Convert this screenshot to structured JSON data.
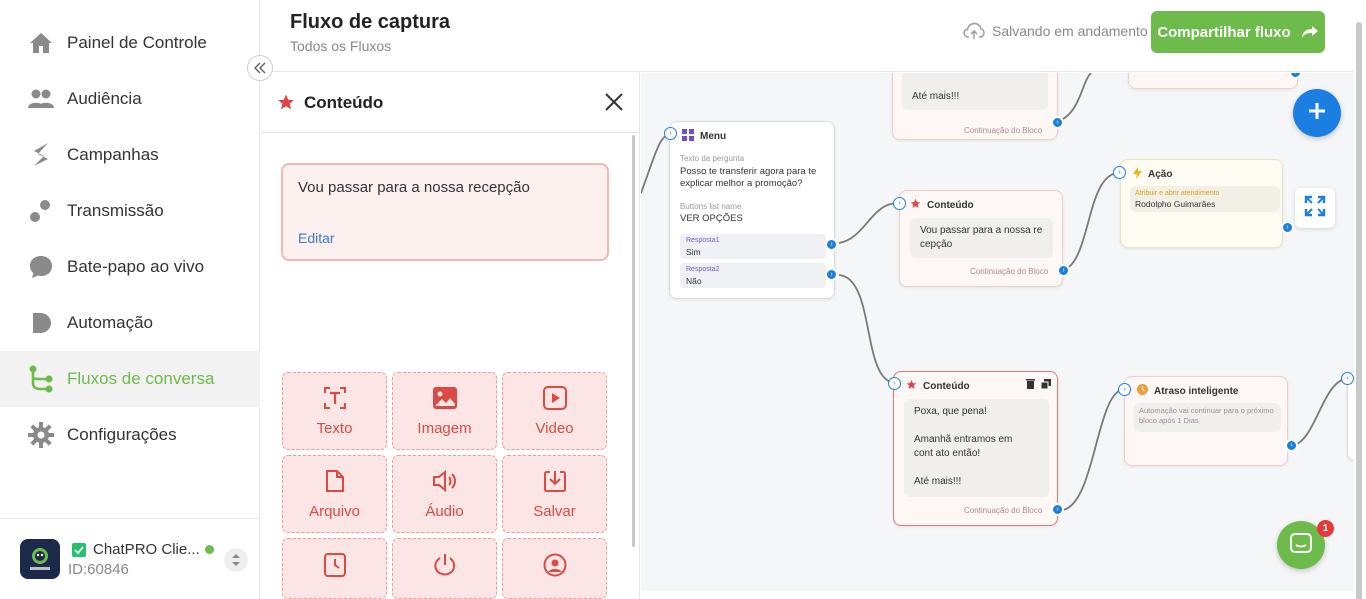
{
  "sidebar": {
    "items": [
      {
        "label": "Painel de Controle",
        "icon": "home-icon"
      },
      {
        "label": "Audiência",
        "icon": "users-icon"
      },
      {
        "label": "Campanhas",
        "icon": "campaign-icon"
      },
      {
        "label": "Transmissão",
        "icon": "broadcast-icon"
      },
      {
        "label": "Bate-papo ao vivo",
        "icon": "chat-icon"
      },
      {
        "label": "Automação",
        "icon": "automation-icon"
      },
      {
        "label": "Fluxos de conversa",
        "icon": "flow-icon",
        "active": true
      },
      {
        "label": "Configurações",
        "icon": "gear-icon"
      }
    ],
    "account": {
      "name": "ChatPRO Clie...",
      "id": "ID:60846",
      "logo_text": "ChatPRO"
    }
  },
  "header": {
    "title": "Fluxo de captura",
    "subtitle": "Todos os Fluxos",
    "saving_status": "Salvando em andamento",
    "share_label": "Compartilhar fluxo"
  },
  "panel": {
    "title": "Conteúdo",
    "message": "Vou passar para a nossa recepção",
    "edit_label": "Editar",
    "tiles": [
      {
        "label": "Texto",
        "icon": "text-icon"
      },
      {
        "label": "Imagem",
        "icon": "image-icon"
      },
      {
        "label": "Video",
        "icon": "video-icon"
      },
      {
        "label": "Arquivo",
        "icon": "file-icon"
      },
      {
        "label": "Áudio",
        "icon": "audio-icon"
      },
      {
        "label": "Salvar",
        "icon": "save-icon"
      },
      {
        "label": "",
        "icon": "clock-icon"
      },
      {
        "label": "",
        "icon": "power-icon"
      },
      {
        "label": "",
        "icon": "contact-icon"
      }
    ]
  },
  "canvas": {
    "top_node": {
      "text": "Até mais!!!",
      "continuation": "Continuação do Bloco"
    },
    "menu_node": {
      "title": "Menu",
      "question_label": "Texto da pergunta",
      "question": "Posso te transferir agora para te explicar melhor a promoção?",
      "buttons_label": "Buttons list name",
      "buttons_value": "VER OPÇÕES",
      "answers": [
        {
          "label": "Resposta1",
          "value": "Sim"
        },
        {
          "label": "Resposta2",
          "value": "Não"
        }
      ]
    },
    "content_node_1": {
      "title": "Conteúdo",
      "text": "Vou passar para a nossa re cepção",
      "continuation": "Continuação do Bloco"
    },
    "action_node": {
      "title": "Ação",
      "field_label": "Atribuir e abrir atendimento",
      "field_value": "Rodolpho Guimarães"
    },
    "content_node_2": {
      "title": "Conteúdo",
      "lines": [
        "Poxa, que pena!",
        "Amanhã entramos em cont ato então!",
        "Até mais!!!"
      ],
      "continuation": "Continuação do Bloco"
    },
    "delay_node": {
      "title": "Atraso inteligente",
      "text": "Automação vai continuar para o próximo bloco após 1 Dias"
    }
  },
  "chat_widget": {
    "badge": "1"
  },
  "colors": {
    "brand_green": "#6dbb4a",
    "accent_blue": "#1a7fe0",
    "tile_red": "#d94b44"
  }
}
